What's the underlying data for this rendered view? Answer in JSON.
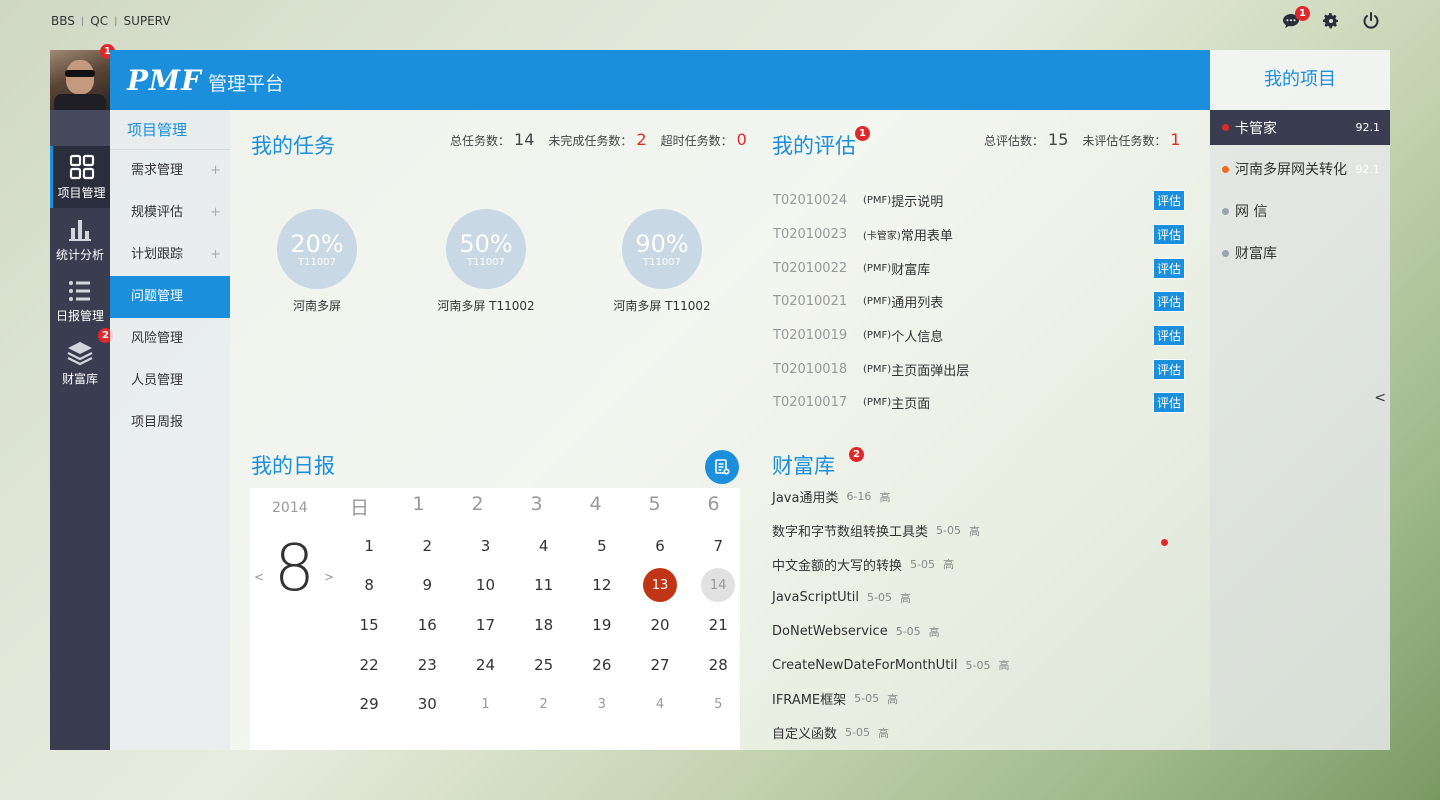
{
  "top_links": [
    "BBS",
    "QC",
    "SUPERV"
  ],
  "top_icons": {
    "message_badge": "1"
  },
  "user": {
    "avatar_badge": "1"
  },
  "rail": [
    {
      "label": "项目管理",
      "icon": "grid-icon",
      "active": true
    },
    {
      "label": "统计分析",
      "icon": "bar-chart-icon"
    },
    {
      "label": "日报管理",
      "icon": "list-icon"
    },
    {
      "label": "财富库",
      "icon": "layers-icon",
      "badge": "2"
    }
  ],
  "header": {
    "logo": "PMF",
    "subtitle": "管理平台"
  },
  "menu": {
    "title": "项目管理",
    "items": [
      {
        "label": "需求管理",
        "expandable": true
      },
      {
        "label": "规模评估",
        "expandable": true
      },
      {
        "label": "计划跟踪",
        "expandable": true
      },
      {
        "label": "问题管理",
        "active": true
      },
      {
        "label": "风险管理"
      },
      {
        "label": "人员管理"
      },
      {
        "label": "项目周报"
      }
    ]
  },
  "tasks": {
    "title": "我的任务",
    "total_label": "总任务数：",
    "total": "14",
    "unfinished_label": "未完成任务数：",
    "unfinished": "2",
    "overdue_label": "超时任务数：",
    "overdue": "0",
    "items": [
      {
        "percent": "20%",
        "code": "T11007",
        "caption": "河南多屏"
      },
      {
        "percent": "50%",
        "code": "T11007",
        "caption": "河南多屏 T11002"
      },
      {
        "percent": "90%",
        "code": "T11007",
        "caption": "河南多屏 T11002"
      }
    ]
  },
  "evaluation": {
    "title": "我的评估",
    "badge": "1",
    "total_label": "总评估数：",
    "total": "15",
    "pending_label": "未评估任务数：",
    "pending": "1",
    "button": "评估",
    "items": [
      {
        "code": "T02010024",
        "tag": "(PMF)",
        "name": "提示说明"
      },
      {
        "code": "T02010023",
        "tag": "(卡管家)",
        "name": "常用表单"
      },
      {
        "code": "T02010022",
        "tag": "(PMF)",
        "name": "财富库"
      },
      {
        "code": "T02010021",
        "tag": "(PMF)",
        "name": "通用列表"
      },
      {
        "code": "T02010019",
        "tag": "(PMF)",
        "name": "个人信息"
      },
      {
        "code": "T02010018",
        "tag": "(PMF)",
        "name": "主页面弹出层"
      },
      {
        "code": "T02010017",
        "tag": "(PMF)",
        "name": "主页面"
      }
    ]
  },
  "daily": {
    "title": "我的日报",
    "year": "2014",
    "month": "8",
    "weekdays": [
      "日",
      "1",
      "2",
      "3",
      "4",
      "5",
      "6"
    ],
    "days": [
      [
        "1",
        "2",
        "3",
        "4",
        "5",
        "6",
        "7"
      ],
      [
        "8",
        "9",
        "10",
        "11",
        "12",
        "13",
        "14"
      ],
      [
        "15",
        "16",
        "17",
        "18",
        "19",
        "20",
        "21"
      ],
      [
        "22",
        "23",
        "24",
        "25",
        "26",
        "27",
        "28"
      ],
      [
        "29",
        "30",
        "1",
        "2",
        "3",
        "4",
        "5"
      ]
    ],
    "today": "13",
    "selected": "14"
  },
  "library": {
    "title": "财富库",
    "badge": "2",
    "items": [
      {
        "name": "Java通用类",
        "date": "6-16",
        "level": "高"
      },
      {
        "name": "数字和字节数组转换工具类",
        "date": "5-05",
        "level": "高"
      },
      {
        "name": "中文金额的大写的转换",
        "date": "5-05",
        "level": "高"
      },
      {
        "name": "JavaScriptUtil",
        "date": "5-05",
        "level": "高"
      },
      {
        "name": "DoNetWebservice",
        "date": "5-05",
        "level": "高"
      },
      {
        "name": "CreateNewDateForMonthUtil",
        "date": "5-05",
        "level": "高"
      },
      {
        "name": "IFRAME框架",
        "date": "5-05",
        "level": "高"
      },
      {
        "name": "自定义函数",
        "date": "5-05",
        "level": "高"
      }
    ]
  },
  "projects": {
    "title": "我的项目",
    "items": [
      {
        "name": "卡管家",
        "score": "92.1",
        "dot": "#e0282a",
        "active": true
      },
      {
        "name": "河南多屏网关转化",
        "score": "92.1",
        "dot": "#f06a1d"
      },
      {
        "name": "网 信",
        "dot": "#9aa3b0"
      },
      {
        "name": "财富库",
        "dot": "#9aa3b0"
      }
    ]
  },
  "colors": {
    "accent": "#1b8fdc",
    "rail": "#3a3d4f",
    "alert": "#e0282a",
    "today": "#c13517"
  }
}
